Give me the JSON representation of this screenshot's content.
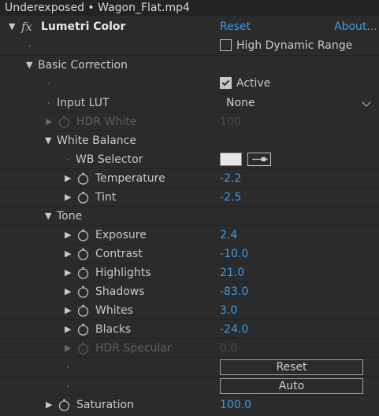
{
  "title_bar": {
    "title": "Underexposed • Wagon_Flat.mp4"
  },
  "effect": {
    "name": "Lumetri Color",
    "reset_label": "Reset",
    "about_label": "About...",
    "hdr_label": "High Dynamic Range",
    "hdr_checked": false
  },
  "basic_correction": {
    "label": "Basic Correction",
    "active_label": "Active",
    "active_checked": true,
    "input_lut_label": "Input LUT",
    "input_lut_value": "None",
    "hdr_white_label": "HDR White",
    "hdr_white_value": "100"
  },
  "white_balance": {
    "label": "White Balance",
    "wb_selector_label": "WB Selector",
    "swatch_color": "#e6e6e6",
    "temperature_label": "Temperature",
    "temperature_value": "-2.2",
    "tint_label": "Tint",
    "tint_value": "-2.5"
  },
  "tone": {
    "label": "Tone",
    "exposure_label": "Exposure",
    "exposure_value": "2.4",
    "contrast_label": "Contrast",
    "contrast_value": "-10.0",
    "highlights_label": "Highlights",
    "highlights_value": "21.0",
    "shadows_label": "Shadows",
    "shadows_value": "-83.0",
    "whites_label": "Whites",
    "whites_value": "3.0",
    "blacks_label": "Blacks",
    "blacks_value": "-24.0",
    "hdr_specular_label": "HDR Specular",
    "hdr_specular_value": "0.0",
    "reset_button": "Reset",
    "auto_button": "Auto"
  },
  "saturation": {
    "label": "Saturation",
    "value": "100.0"
  },
  "colors": {
    "accent": "#3d9ae8",
    "background": "#2b2b2b"
  }
}
